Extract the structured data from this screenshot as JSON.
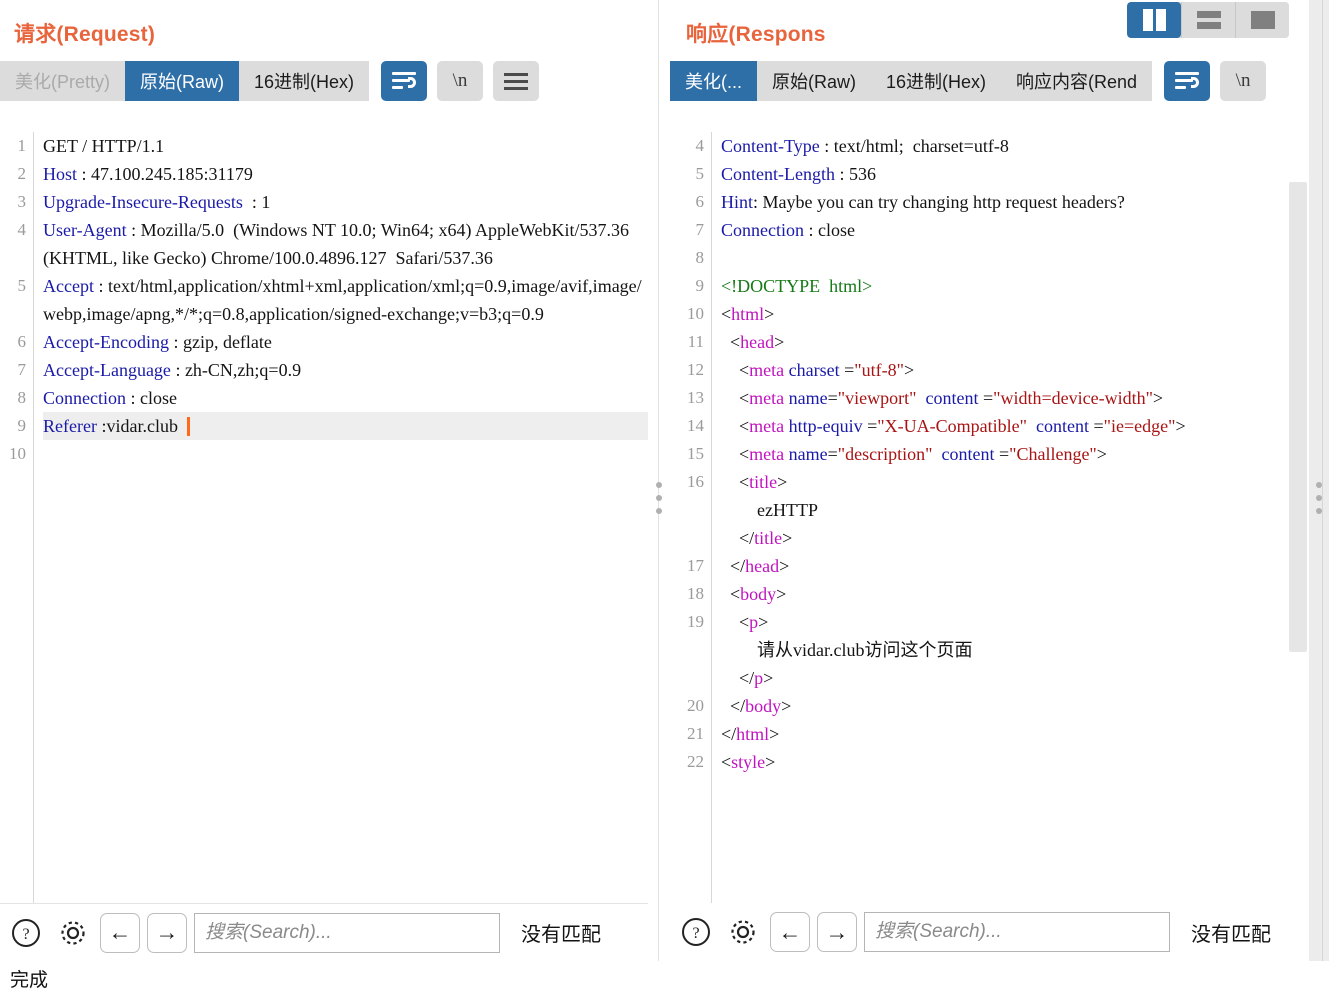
{
  "layout_toggle": {
    "buttons": [
      {
        "name": "split-vertical",
        "active": true
      },
      {
        "name": "split-horizontal",
        "active": false
      },
      {
        "name": "single-pane",
        "active": false
      }
    ]
  },
  "request": {
    "title": "请求(Request)",
    "tabs": [
      {
        "label": "美化(Pretty)",
        "state": "disabled"
      },
      {
        "label": "原始(Raw)",
        "state": "active"
      },
      {
        "label": "16进制(Hex)",
        "state": "normal"
      }
    ],
    "tools": [
      {
        "icon": "word-wrap-icon",
        "label": "",
        "active": true
      },
      {
        "icon": "newline-icon",
        "label": "\\n",
        "active": false
      },
      {
        "icon": "menu-icon",
        "label": "",
        "active": false
      }
    ],
    "lines": [
      {
        "n": "1",
        "html": "GET / HTTP/1.1"
      },
      {
        "n": "2",
        "html": "<span class=\"hdr\">Host</span> : 47.100.245.185:31179"
      },
      {
        "n": "3",
        "html": "<span class=\"hdr\">Upgrade-Insecure-Requests</span>  : 1"
      },
      {
        "n": "4",
        "html": "<span class=\"hdr\">User-Agent</span> : Mozilla/5.0  (Windows NT 10.0; Win64; x64) AppleWebKit/537.36  (KHTML, like Gecko) Chrome/100.0.4896.127  Safari/537.36"
      },
      {
        "n": "5",
        "html": "<span class=\"hdr\">Accept</span> : text/html,application/xhtml+xml,application/xml;q=0.9,image/avif,image/webp,image/apng,*/*;q=0.8,application/signed-exchange;v=b3;q=0.9"
      },
      {
        "n": "6",
        "html": "<span class=\"hdr\">Accept-Encoding</span> : gzip, deflate"
      },
      {
        "n": "7",
        "html": "<span class=\"hdr\">Accept-Language</span> : zh-CN,zh;q=0.9"
      },
      {
        "n": "8",
        "html": "<span class=\"hdr\">Connection</span> : close"
      },
      {
        "n": "9",
        "html": "<span class=\"hdr\">Referer</span> :vidar.club<span class=\"cursor\"></span>",
        "current": true
      },
      {
        "n": "10",
        "html": ""
      }
    ],
    "findbar": {
      "help_icon": "help-icon",
      "settings_icon": "gear-icon",
      "prev_label": "←",
      "next_label": "→",
      "search_placeholder": "搜索(Search)...",
      "search_value": "",
      "match_label": "没有匹配"
    }
  },
  "response": {
    "title": "响应(Respons",
    "tabs": [
      {
        "label": "美化(...",
        "state": "active"
      },
      {
        "label": "原始(Raw)",
        "state": "normal"
      },
      {
        "label": "16进制(Hex)",
        "state": "normal"
      },
      {
        "label": "响应内容(Rend",
        "state": "normal"
      }
    ],
    "tools": [
      {
        "icon": "word-wrap-icon",
        "label": "",
        "active": true
      },
      {
        "icon": "newline-icon",
        "label": "\\n",
        "active": false
      }
    ],
    "lines": [
      {
        "n": "4",
        "html": "<span class=\"hdr\">Content-Type</span> : text/html;  charset=utf-8"
      },
      {
        "n": "5",
        "html": "<span class=\"hdr\">Content-Length</span> : 536"
      },
      {
        "n": "6",
        "html": "<span class=\"hdr\">Hint</span>: Maybe you can try changing http request headers?"
      },
      {
        "n": "7",
        "html": "<span class=\"hdr\">Connection</span> : close"
      },
      {
        "n": "8",
        "html": ""
      },
      {
        "n": "9",
        "html": "<span class=\"doct\">&lt;!DOCTYPE  html&gt;</span>"
      },
      {
        "n": "10",
        "html": "&lt;<span class=\"tagp\">html</span>&gt;"
      },
      {
        "n": "11",
        "html": "  &lt;<span class=\"tagp\">head</span>&gt;"
      },
      {
        "n": "12",
        "html": "    &lt;<span class=\"tagp\">meta</span> <span class=\"attr\">charset</span> =<span class=\"str\">\"utf-8\"</span>&gt;"
      },
      {
        "n": "13",
        "html": "    &lt;<span class=\"tagp\">meta</span> <span class=\"attr\">name</span>=<span class=\"str\">\"viewport\"</span>  <span class=\"attr\">content</span> =<span class=\"str\">\"width=device-width\"</span>&gt;"
      },
      {
        "n": "14",
        "html": "    &lt;<span class=\"tagp\">meta</span> <span class=\"attr\">http-equiv</span> =<span class=\"str\">\"X-UA-Compatible\"</span>  <span class=\"attr\">content</span> =<span class=\"str\">\"ie=edge\"</span>&gt;"
      },
      {
        "n": "15",
        "html": "    &lt;<span class=\"tagp\">meta</span> <span class=\"attr\">name</span>=<span class=\"str\">\"description\"</span>  <span class=\"attr\">content</span> =<span class=\"str\">\"Challenge\"</span>&gt;"
      },
      {
        "n": "16",
        "html": "    &lt;<span class=\"tagp\">title</span>&gt;\n        ezHTTP\n    &lt;/<span class=\"tagp\">title</span>&gt;\n"
      },
      {
        "n": "17",
        "html": "  &lt;/<span class=\"tagp\">head</span>&gt;"
      },
      {
        "n": "18",
        "html": "  &lt;<span class=\"tagp\">body</span>&gt;"
      },
      {
        "n": "19",
        "html": "    &lt;<span class=\"tagp\">p</span>&gt;\n        请从vidar.club访问这个页面\n    &lt;/<span class=\"tagp\">p</span>&gt;"
      },
      {
        "n": "20",
        "html": "  &lt;/<span class=\"tagp\">body</span>&gt;"
      },
      {
        "n": "21",
        "html": "&lt;/<span class=\"tagp\">html</span>&gt;"
      },
      {
        "n": "22",
        "html": "&lt;<span class=\"tagp\">style</span>&gt;"
      }
    ],
    "findbar": {
      "help_icon": "help-icon",
      "settings_icon": "gear-icon",
      "prev_label": "←",
      "next_label": "→",
      "search_placeholder": "搜索(Search)...",
      "search_value": "",
      "match_label": "没有匹配"
    }
  },
  "status": {
    "text": "完成"
  },
  "colors": {
    "accent_blue": "#2f6fa8",
    "title_orange": "#e8643c",
    "tab_bg": "#dcdcdc",
    "header_key": "#1a1aa8",
    "tag": "#c014c0",
    "string": "#a81414",
    "doctype": "#157a15",
    "cursor": "#ff6a1a"
  }
}
